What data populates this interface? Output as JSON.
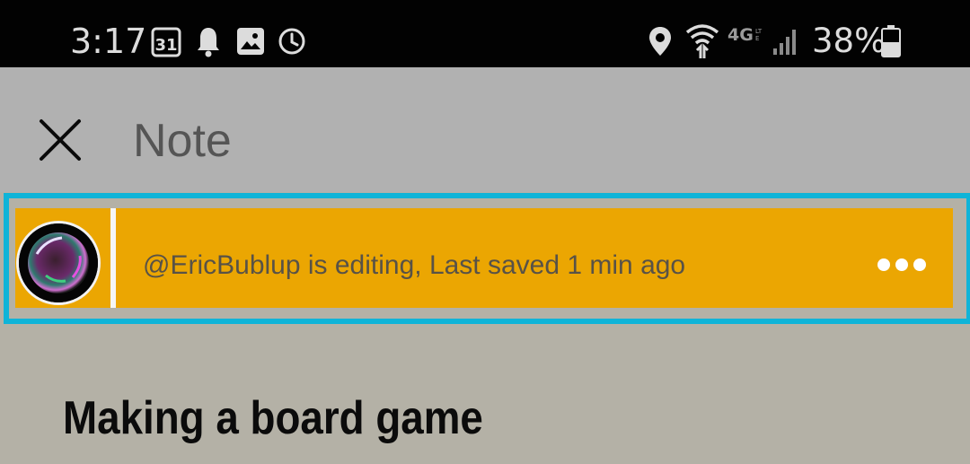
{
  "status_bar": {
    "time": "3:17",
    "battery_percent": "38%",
    "network_label": "4G LTE",
    "icons": [
      "calendar-31-icon",
      "bell-icon",
      "image-icon",
      "alarm-clock-icon",
      "location-icon",
      "wifi-icon",
      "signal-icon",
      "battery-icon"
    ]
  },
  "header": {
    "title": "Note",
    "close_icon": "close-icon"
  },
  "edit_banner": {
    "text": "@EricBublup is editing, Last saved 1 min ago",
    "avatar": "avatar",
    "more_icon": "more-horizontal-icon"
  },
  "note": {
    "title": "Making a board game"
  },
  "colors": {
    "status_bar_bg": "#020202",
    "header_bg": "#b1b1b1",
    "page_bg": "#b4b1a6",
    "banner_bg": "#eba602",
    "highlight": "#0fb4d8"
  }
}
